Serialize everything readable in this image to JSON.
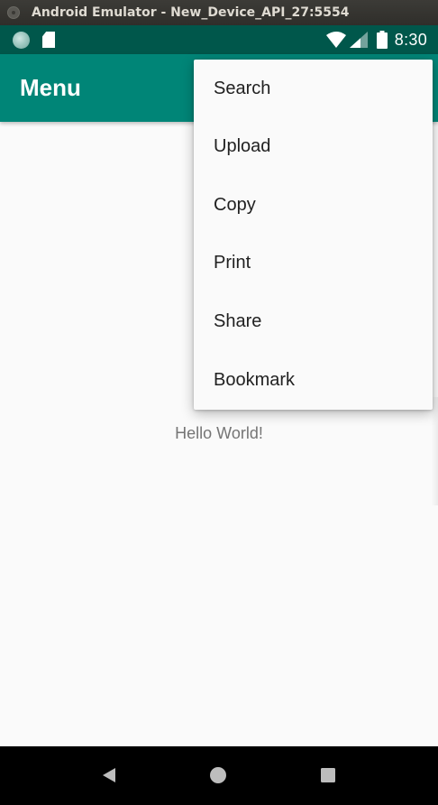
{
  "window": {
    "title": "Android Emulator - New_Device_API_27:5554"
  },
  "status_bar": {
    "time": "8:30",
    "icons": [
      "notification-dot-icon",
      "sd-card-icon",
      "wifi-icon",
      "signal-icon",
      "battery-icon"
    ]
  },
  "app_bar": {
    "title": "Menu"
  },
  "content": {
    "text": "Hello World!"
  },
  "popup_menu": {
    "items": [
      "Search",
      "Upload",
      "Copy",
      "Print",
      "Share",
      "Bookmark"
    ]
  },
  "nav_bar": {
    "icons": [
      "back-icon",
      "home-icon",
      "recents-icon"
    ]
  },
  "colors": {
    "primary": "#008577",
    "primary_dark": "#00574b",
    "background": "#fafafa",
    "menu_text": "#212121",
    "body_text": "#757575"
  }
}
